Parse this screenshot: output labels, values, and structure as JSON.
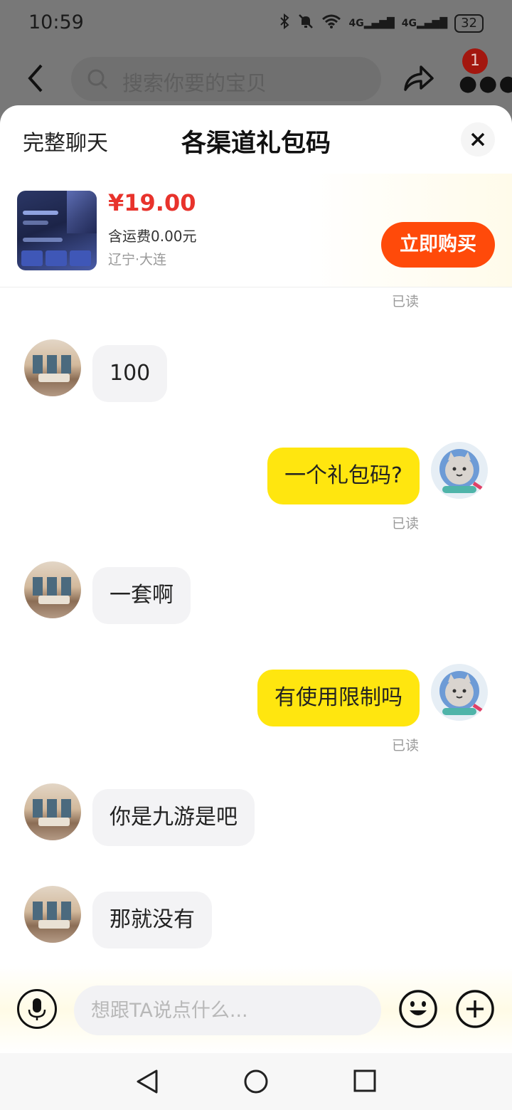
{
  "status_bar": {
    "time": "10:59",
    "signal_1": "4G",
    "signal_2": "4G",
    "battery": "32"
  },
  "background_page": {
    "search_placeholder": "搜索你要的宝贝",
    "badge_count": "1"
  },
  "sheet": {
    "full_chat_label": "完整聊天",
    "title": "各渠道礼包码",
    "close_icon": "close-icon"
  },
  "product": {
    "price": "¥19.00",
    "shipping": "含运费0.00元",
    "location": "辽宁·大连",
    "buy_label": "立即购买"
  },
  "messages": [
    {
      "side": "left",
      "text": "100"
    },
    {
      "side": "right",
      "text": "一个礼包码?",
      "status": "已读"
    },
    {
      "side": "left",
      "text": "一套啊"
    },
    {
      "side": "right",
      "text": "有使用限制吗",
      "status": "已读"
    },
    {
      "side": "left",
      "text": "你是九游是吧"
    },
    {
      "side": "left",
      "text": "那就没有"
    }
  ],
  "top_read_status": "已读",
  "input": {
    "placeholder": "想跟TA说点什么..."
  },
  "colors": {
    "accent_yellow": "#ffe60f",
    "buy_orange": "#ff4a0a",
    "price_red": "#e8332c"
  }
}
